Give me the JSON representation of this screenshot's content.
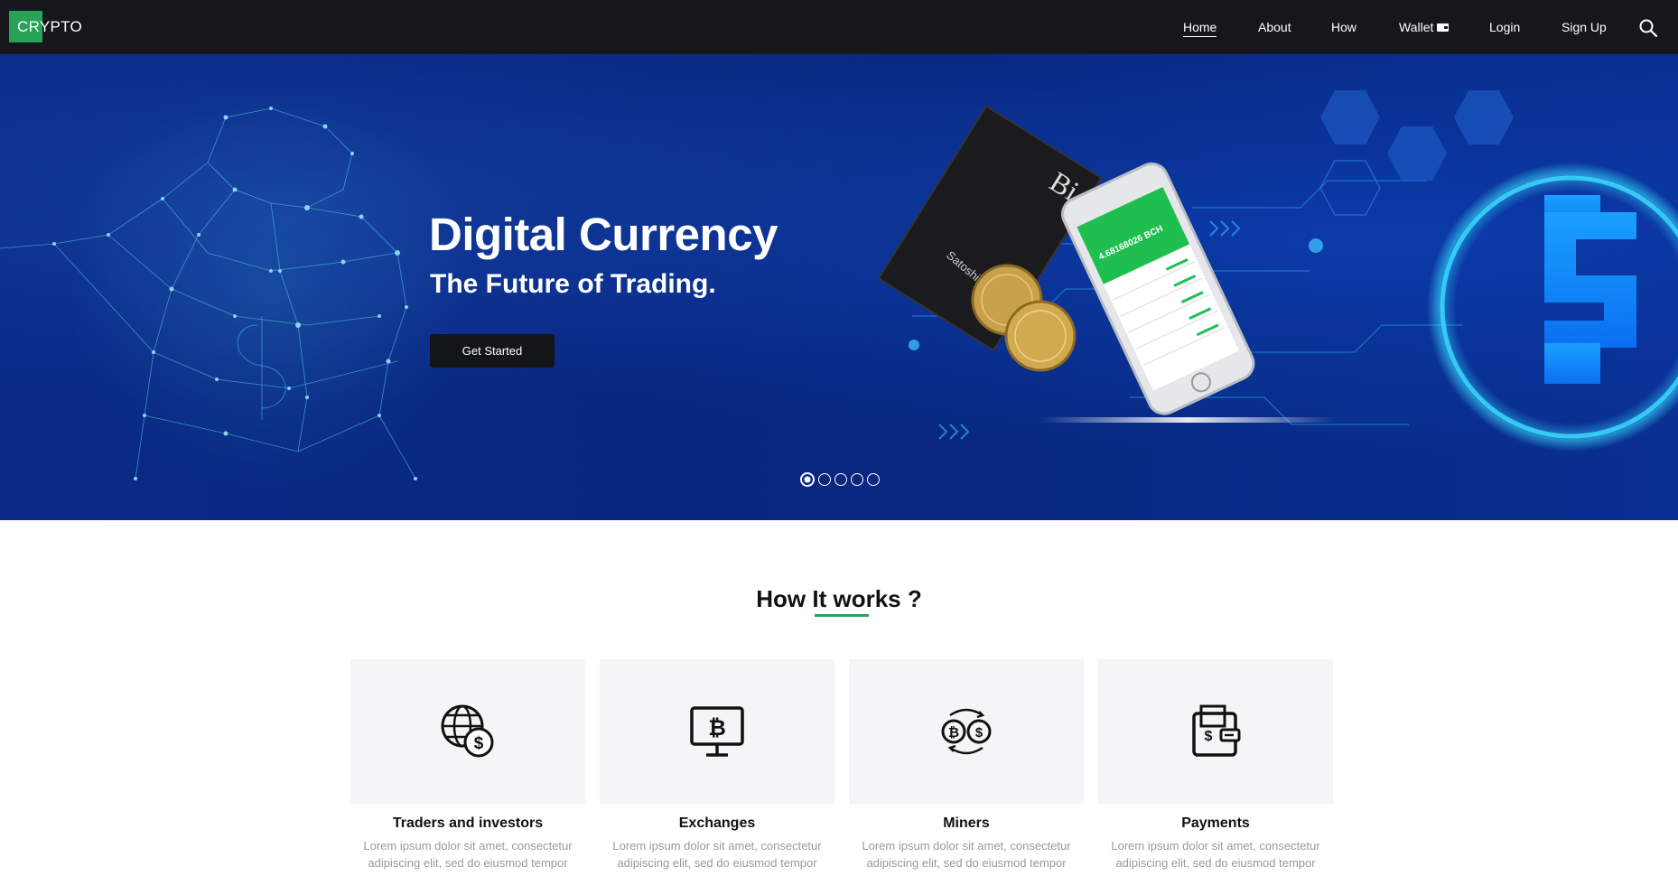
{
  "nav": {
    "logo": "CRYPTO",
    "links": [
      "Home",
      "About",
      "How",
      "Wallet",
      "Login",
      "Sign Up"
    ],
    "active": "Home"
  },
  "hero": {
    "title": "Digital Currency",
    "subtitle": "The Future of Trading.",
    "button": "Get Started",
    "slides": 5,
    "active_slide": 1,
    "phone_balance": "4.68168026 BCH",
    "book_author": "Satoshi Nakamoto"
  },
  "how": {
    "title": "How It works ?",
    "cards": [
      {
        "icon": "globe-dollar-icon",
        "title": "Traders and investors",
        "text": "Lorem ipsum dolor sit amet, consectetur adipiscing elit, sed do eiusmod tempor"
      },
      {
        "icon": "monitor-bitcoin-icon",
        "title": "Exchanges",
        "text": "Lorem ipsum dolor sit amet, consectetur adipiscing elit, sed do eiusmod tempor"
      },
      {
        "icon": "bitcoin-dollar-exchange-icon",
        "title": "Miners",
        "text": "Lorem ipsum dolor sit amet, consectetur adipiscing elit, sed do eiusmod tempor"
      },
      {
        "icon": "wallet-dollar-icon",
        "title": "Payments",
        "text": "Lorem ipsum dolor sit amet, consectetur adipiscing elit, sed do eiusmod tempor"
      }
    ]
  },
  "colors": {
    "nav_bg": "#15171c",
    "accent": "#27a358",
    "hero_bg": "#0a2a86",
    "card_bg": "#f5f5f7"
  }
}
